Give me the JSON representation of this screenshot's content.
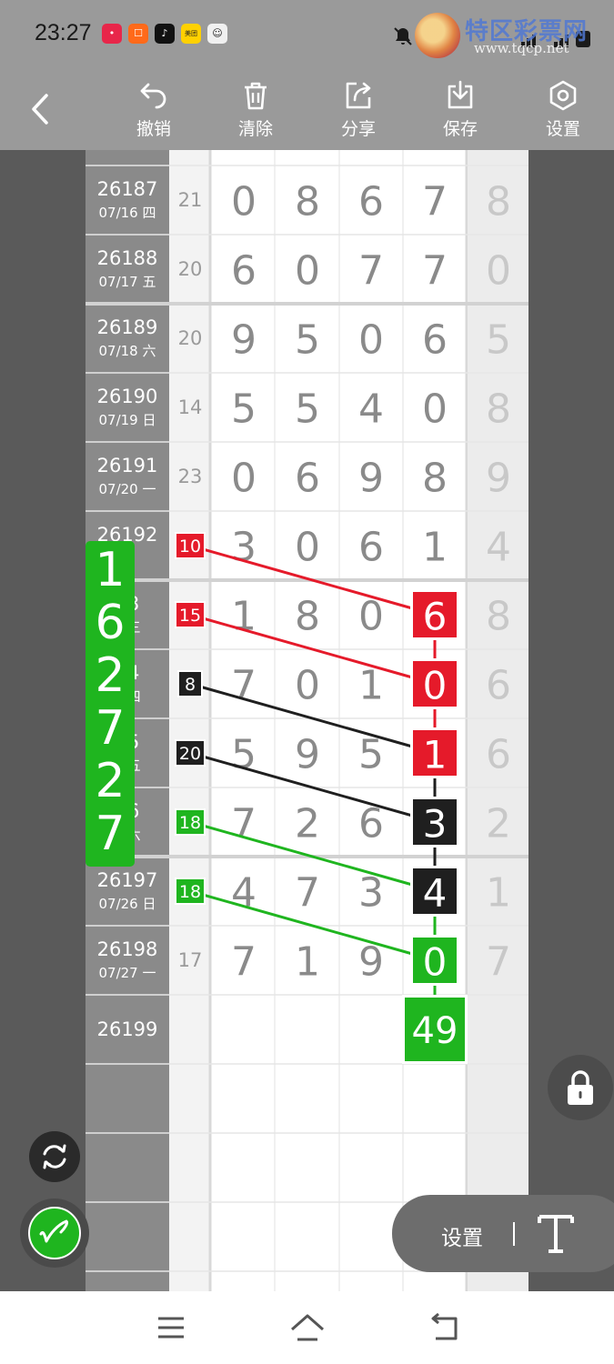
{
  "status_bar": {
    "time": "23:27",
    "watermark_name": "特区彩票网",
    "watermark_url": "www.tqcp.net",
    "app_icons": [
      {
        "name": "app-icon-red",
        "color": "#e8264a",
        "glyph": "•"
      },
      {
        "name": "app-icon-orange",
        "color": "#ff6a1a",
        "glyph": "☐"
      },
      {
        "name": "app-icon-tiktok",
        "color": "#111111",
        "glyph": "♪"
      },
      {
        "name": "app-icon-meituan",
        "color": "#ffd100",
        "glyph": "美团"
      },
      {
        "name": "app-icon-avatar",
        "color": "#f0f0f0",
        "glyph": "☺"
      }
    ]
  },
  "toolbar": {
    "undo_label": "撤销",
    "clear_label": "清除",
    "share_label": "分享",
    "save_label": "保存",
    "settings_label": "设置"
  },
  "rows": [
    {
      "id": "26187",
      "date": "07/16 四",
      "sum": "21",
      "digits": [
        "0",
        "8",
        "6",
        "7",
        "8"
      ]
    },
    {
      "id": "26188",
      "date": "07/17 五",
      "sum": "20",
      "digits": [
        "6",
        "0",
        "7",
        "7",
        "0"
      ]
    },
    {
      "id": "26189",
      "date": "07/18 六",
      "sum": "20",
      "digits": [
        "9",
        "5",
        "0",
        "6",
        "5"
      ]
    },
    {
      "id": "26190",
      "date": "07/19 日",
      "sum": "14",
      "digits": [
        "5",
        "5",
        "4",
        "0",
        "8"
      ]
    },
    {
      "id": "26191",
      "date": "07/20 一",
      "sum": "23",
      "digits": [
        "0",
        "6",
        "9",
        "8",
        "9"
      ]
    },
    {
      "id": "26192",
      "date": "二",
      "sum": "10",
      "digits": [
        "3",
        "0",
        "6",
        "1",
        "4"
      ]
    },
    {
      "id": "93",
      "date": "2 三",
      "sum": "15",
      "digits": [
        "1",
        "8",
        "0",
        "6",
        "8"
      ]
    },
    {
      "id": "94",
      "date": "3 四",
      "sum": "8",
      "digits": [
        "7",
        "0",
        "1",
        "0",
        "6"
      ]
    },
    {
      "id": "95",
      "date": "4 五",
      "sum": "20",
      "digits": [
        "5",
        "9",
        "5",
        "1",
        "6"
      ]
    },
    {
      "id": "96",
      "date": "5 六",
      "sum": "18",
      "digits": [
        "7",
        "2",
        "6",
        "3",
        "2"
      ]
    },
    {
      "id": "26197",
      "date": "07/26 日",
      "sum": "18",
      "digits": [
        "4",
        "7",
        "3",
        "4",
        "1"
      ]
    },
    {
      "id": "26198",
      "date": "07/27 一",
      "sum": "17",
      "digits": [
        "7",
        "1",
        "9",
        "0",
        "7"
      ]
    },
    {
      "id": "26199",
      "date": "",
      "sum": "",
      "digits": [
        "",
        "",
        "",
        "49",
        ""
      ]
    }
  ],
  "annotations": {
    "sum_badges": [
      {
        "row": 5,
        "value": "10",
        "color": "#e51a2a"
      },
      {
        "row": 6,
        "value": "15",
        "color": "#e51a2a"
      },
      {
        "row": 7,
        "value": "8",
        "color": "#1f1f1f"
      },
      {
        "row": 8,
        "value": "20",
        "color": "#1f1f1f"
      },
      {
        "row": 9,
        "value": "18",
        "color": "#1fb51f"
      },
      {
        "row": 10,
        "value": "18",
        "color": "#1fb51f"
      }
    ],
    "highlight_cells": [
      {
        "row": 6,
        "col": 3,
        "value": "6",
        "color": "#e51a2a"
      },
      {
        "row": 7,
        "col": 3,
        "value": "0",
        "color": "#e51a2a"
      },
      {
        "row": 8,
        "col": 3,
        "value": "1",
        "color": "#e51a2a"
      },
      {
        "row": 9,
        "col": 3,
        "value": "3",
        "color": "#1f1f1f"
      },
      {
        "row": 10,
        "col": 3,
        "value": "4",
        "color": "#1f1f1f"
      },
      {
        "row": 11,
        "col": 3,
        "value": "0",
        "color": "#1fb51f"
      },
      {
        "row": 12,
        "col": 3,
        "value": "49",
        "color": "#1fb51f"
      }
    ],
    "vertical_note": {
      "text": "162727",
      "color": "#1fb51f"
    }
  },
  "controls": {
    "settings_label": "设置"
  }
}
